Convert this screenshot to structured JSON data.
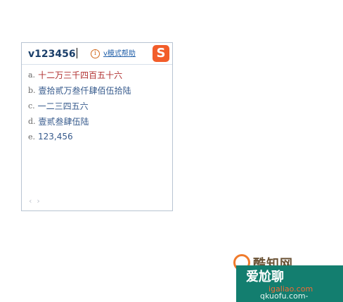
{
  "ime": {
    "composition": "v123456",
    "help_label": "v模式帮助",
    "logo_text": "S",
    "candidates": [
      {
        "key": "a.",
        "text": "十二万三千四百五十六"
      },
      {
        "key": "b.",
        "text": "壹拾贰万叁仟肆佰伍拾陆"
      },
      {
        "key": "c.",
        "text": "一二三四五六"
      },
      {
        "key": "d.",
        "text": "壹贰叁肆伍陆"
      },
      {
        "key": "e.",
        "text": "123,456"
      }
    ],
    "prev_page": "‹",
    "next_page": "›"
  },
  "watermark": {
    "brand": "酷知网",
    "main": "爱尬聊",
    "domain": "igaliao.com",
    "sub": "qkuofu.com-"
  },
  "colors": {
    "panel_border": "#b8c4d2",
    "composition_text": "#1b3f6a",
    "selected_candidate": "#b03030",
    "candidate_text": "#365a8c",
    "help_link": "#1f5ea8",
    "logo_bg": "#f25d2a",
    "watermark_band": "#137e6f"
  }
}
